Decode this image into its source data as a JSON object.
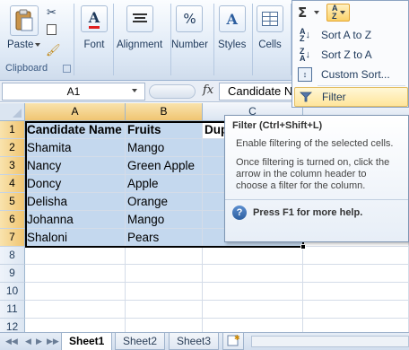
{
  "ribbon": {
    "paste_label": "Paste",
    "clipboard_label": "Clipboard",
    "font_label": "Font",
    "alignment_label": "Alignment",
    "number_label": "Number",
    "number_icon": "%",
    "styles_label": "Styles",
    "cells_label": "Cells",
    "autosum_icon": "Σ"
  },
  "formula_bar": {
    "name_box": "A1",
    "fx": "fx",
    "formula": "Candidate Name"
  },
  "columns": [
    "A",
    "B",
    "C"
  ],
  "rows": [
    "1",
    "2",
    "3",
    "4",
    "5",
    "6",
    "7",
    "8",
    "9",
    "10",
    "11",
    "12"
  ],
  "table": {
    "headers": [
      "Candidate Name",
      "Fruits",
      "Dup"
    ],
    "data": [
      [
        "Shamita",
        "Mango"
      ],
      [
        "Nancy",
        "Green Apple"
      ],
      [
        "Doncy",
        "Apple"
      ],
      [
        "Delisha",
        "Orange"
      ],
      [
        "Johanna",
        "Mango"
      ],
      [
        "Shaloni",
        "Pears"
      ]
    ]
  },
  "sort_filter_menu": {
    "items": [
      {
        "label": "Sort A to Z",
        "icon": "sort-a-z-icon"
      },
      {
        "label": "Sort Z to A",
        "icon": "sort-z-a-icon"
      },
      {
        "label": "Custom Sort...",
        "icon": "custom-sort-icon"
      },
      {
        "label": "Filter",
        "icon": "filter-icon"
      }
    ]
  },
  "tooltip": {
    "title": "Filter (Ctrl+Shift+L)",
    "line1": "Enable filtering of the selected cells.",
    "line2": "Once filtering is turned on, click the arrow in the column header to choose a filter for the column.",
    "help": "Press F1 for more help."
  },
  "sheets": [
    "Sheet1",
    "Sheet2",
    "Sheet3"
  ],
  "colors": {
    "selection_fill": "#c4d8ee",
    "selected_header": "#f0c572",
    "ribbon_bg": "#dde8f5"
  }
}
